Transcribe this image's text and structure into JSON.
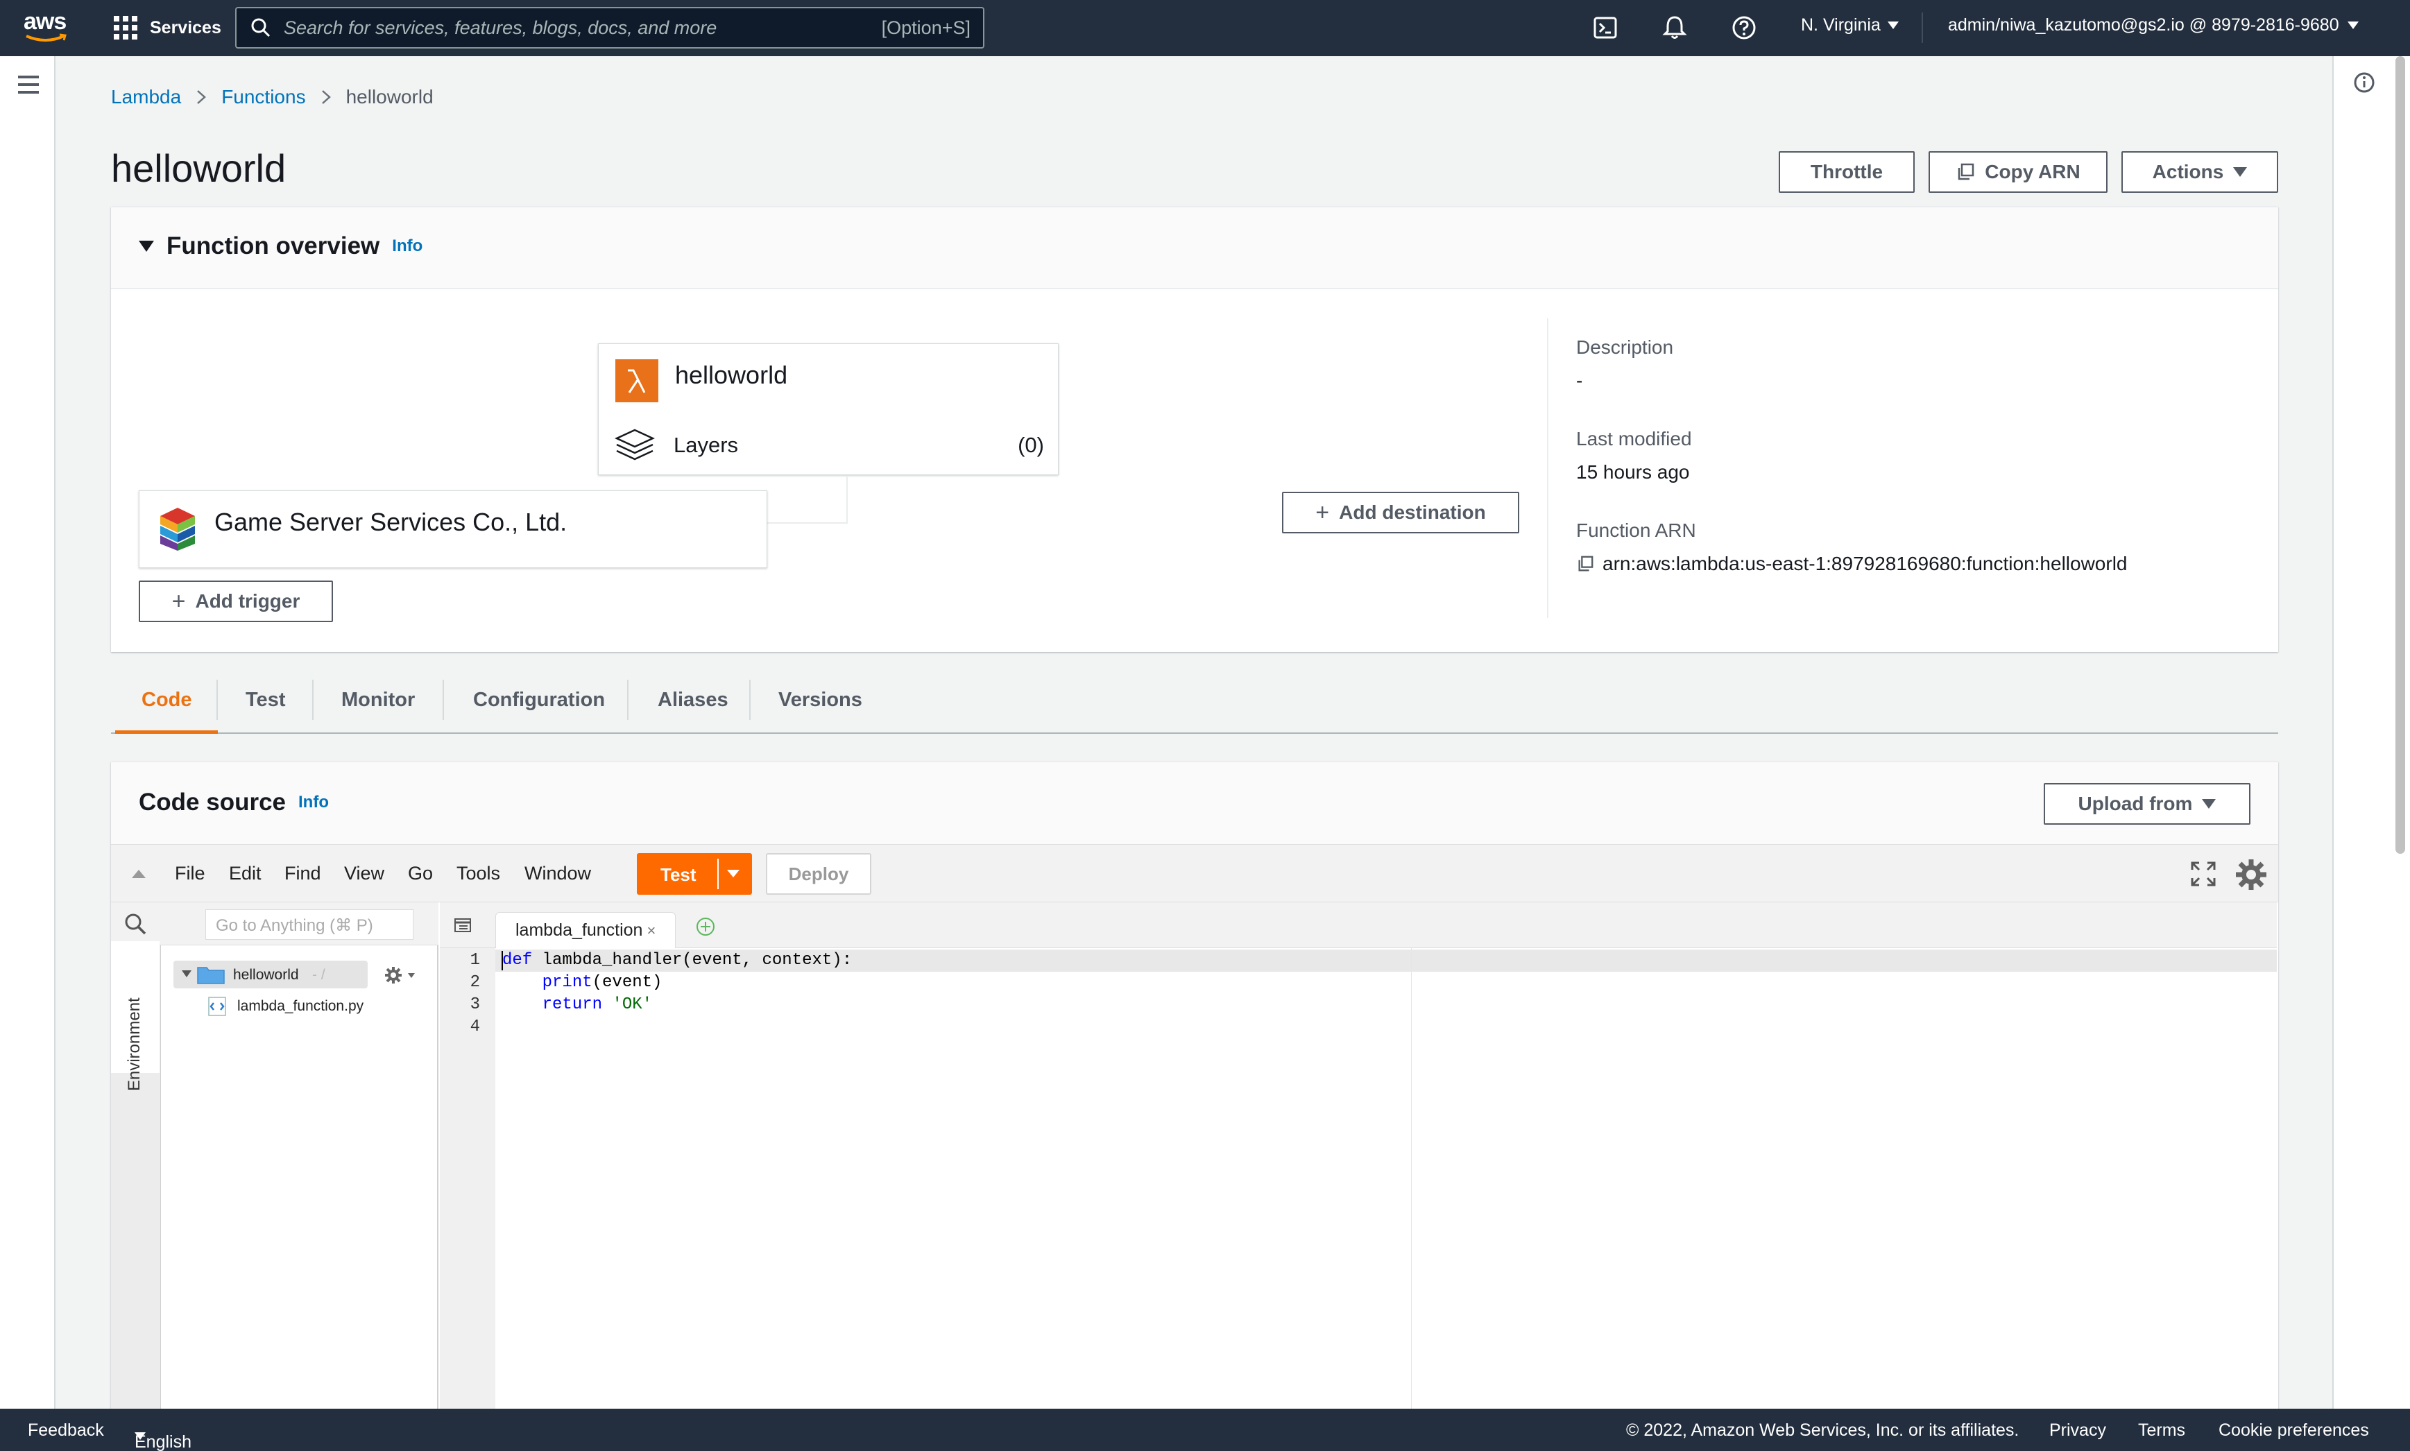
{
  "nav": {
    "logo": "aws",
    "services_label": "Services",
    "search_placeholder": "Search for services, features, blogs, docs, and more",
    "search_shortcut": "[Option+S]",
    "region": "N. Virginia",
    "account": "admin/niwa_kazutomo@gs2.io @ 8979-2816-9680",
    "icons": [
      "cloudshell-icon",
      "bell-icon",
      "help-icon"
    ]
  },
  "breadcrumb": [
    "Lambda",
    "Functions",
    "helloworld"
  ],
  "page": {
    "title": "helloworld",
    "buttons": {
      "throttle": "Throttle",
      "copy_arn": "Copy ARN",
      "actions": "Actions"
    }
  },
  "overview": {
    "title": "Function overview",
    "info": "Info",
    "function_name": "helloworld",
    "layers_label": "Layers",
    "layers_count": "(0)",
    "trigger_name": "Game Server Services Co., Ltd.",
    "add_trigger": "Add trigger",
    "add_destination": "Add destination",
    "description_label": "Description",
    "description_value": "-",
    "last_modified_label": "Last modified",
    "last_modified_value": "15 hours ago",
    "arn_label": "Function ARN",
    "arn_value": "arn:aws:lambda:us-east-1:897928169680:function:helloworld"
  },
  "tabs": [
    "Code",
    "Test",
    "Monitor",
    "Configuration",
    "Aliases",
    "Versions"
  ],
  "active_tab": "Code",
  "code_source": {
    "title": "Code source",
    "info": "Info",
    "upload_from": "Upload from",
    "menu": [
      "File",
      "Edit",
      "Find",
      "View",
      "Go",
      "Tools",
      "Window"
    ],
    "test_label": "Test",
    "deploy_label": "Deploy",
    "goto_placeholder": "Go to Anything (⌘ P)",
    "environment_label": "Environment",
    "folder_name": "helloworld",
    "folder_suffix": "- /",
    "file_name": "lambda_function.py",
    "editor_tab": "lambda_function",
    "line_numbers": [
      "1",
      "2",
      "3",
      "4"
    ],
    "code": {
      "l1_kw": "def",
      "l1_rest": " lambda_handler(event, context):",
      "l2_kw": "    print",
      "l2_rest": "(event)",
      "l3_kw": "    return",
      "l3_sp": " ",
      "l3_str": "'OK'"
    }
  },
  "footer": {
    "feedback": "Feedback",
    "language": "English (US)",
    "copyright": "© 2022, Amazon Web Services, Inc. or its affiliates.",
    "privacy": "Privacy",
    "terms": "Terms",
    "cookies": "Cookie preferences"
  },
  "colors": {
    "nav_bg": "#232f3e",
    "accent": "#ec7211",
    "link": "#0073bb",
    "test_button": "#ff6a00"
  }
}
